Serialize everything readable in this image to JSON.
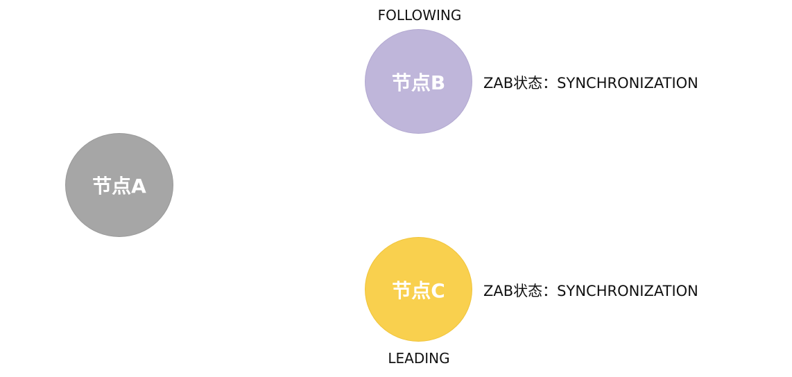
{
  "nodes": {
    "a": {
      "label": "节点A",
      "color": "#a6a6a6"
    },
    "b": {
      "label": "节点B",
      "role": "FOLLOWING",
      "zab_state": "ZAB状态：SYNCHRONIZATION",
      "color": "#bfb6da"
    },
    "c": {
      "label": "节点C",
      "role": "LEADING",
      "zab_state": "ZAB状态：SYNCHRONIZATION",
      "color": "#f9d04e"
    }
  }
}
